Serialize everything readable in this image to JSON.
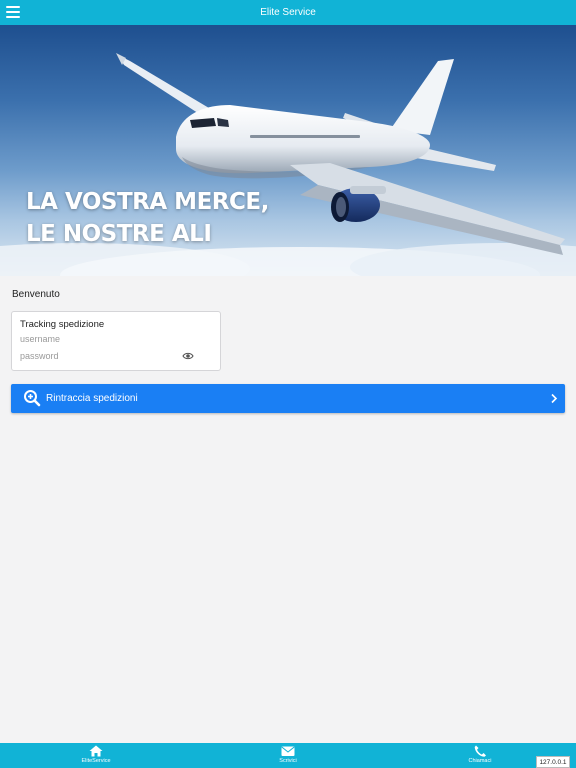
{
  "header": {
    "title": "Elite Service",
    "menu_icon": "hamburger-menu-icon"
  },
  "hero": {
    "tagline_line1": "LA VOSTRA MERCE,",
    "tagline_line2": "LE NOSTRE ALI",
    "image": "airplane-in-sky"
  },
  "welcome": "Benvenuto",
  "login_card": {
    "title": "Tracking spedizione",
    "username_placeholder": "username",
    "username_value": "",
    "password_placeholder": "password",
    "password_value": "",
    "eye_icon": "eye-icon"
  },
  "track_button": {
    "label": "Rintraccia spedizioni",
    "icon": "search-plus-icon",
    "chevron": "chevron-right-icon"
  },
  "tabbar": {
    "tabs": [
      {
        "label": "EliteService",
        "icon": "home-icon"
      },
      {
        "label": "Scrivici",
        "icon": "envelope-icon"
      },
      {
        "label": "Chiamaci",
        "icon": "phone-icon"
      }
    ]
  },
  "ip_badge": "127.0.0.1",
  "colors": {
    "header_bg": "#11b3d6",
    "tabbar_bg": "#11b3d6",
    "primary_button": "#1a7ff4",
    "page_bg": "#f3f3f4"
  }
}
